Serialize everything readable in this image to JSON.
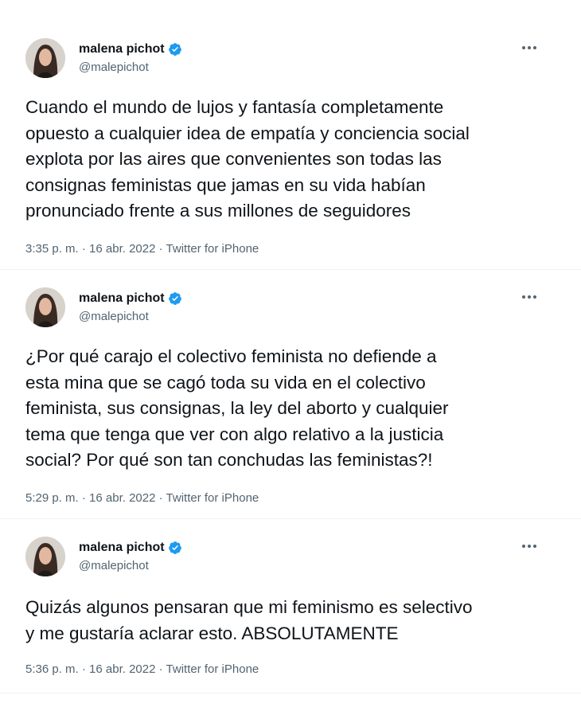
{
  "tweets": [
    {
      "author_name": "malena pichot",
      "author_handle": "@malepichot",
      "text": "Cuando el mundo de lujos y fantasía completamente\nopuesto a cualquier idea de empatía y conciencia social\nexplota por las aires que convenientes son todas las\nconsignas feministas que jamas en su vida habían\npronunciado frente a sus millones de seguidores",
      "time": "3:35 p. m.",
      "date": "16 abr. 2022",
      "source": "Twitter for iPhone",
      "icons": {
        "verified": "verified-badge-icon",
        "more": "more-options-icon"
      }
    },
    {
      "author_name": "malena pichot",
      "author_handle": "@malepichot",
      "text": "¿Por qué carajo el colectivo feminista no defiende a\nesta mina que se cagó toda su vida en el colectivo\nfeminista, sus consignas, la ley del aborto y cualquier\ntema que tenga que ver con algo relativo a la justicia\nsocial? Por qué son tan conchudas las feministas?!",
      "time": "5:29 p. m.",
      "date": "16 abr. 2022",
      "source": "Twitter for iPhone",
      "icons": {
        "verified": "verified-badge-icon",
        "more": "more-options-icon"
      }
    },
    {
      "author_name": "malena pichot",
      "author_handle": "@malepichot",
      "text": "Quizás algunos pensaran que mi feminismo es selectivo\ny me gustaría aclarar esto.  ABSOLUTAMENTE",
      "time": "5:36 p. m.",
      "date": "16 abr. 2022",
      "source": "Twitter for iPhone",
      "icons": {
        "verified": "verified-badge-icon",
        "more": "more-options-icon"
      }
    }
  ],
  "meta_separator": "·",
  "colors": {
    "text_primary": "#0f1419",
    "text_secondary": "#536471",
    "verified_blue": "#1d9bf0",
    "divider": "#eff3f4"
  }
}
